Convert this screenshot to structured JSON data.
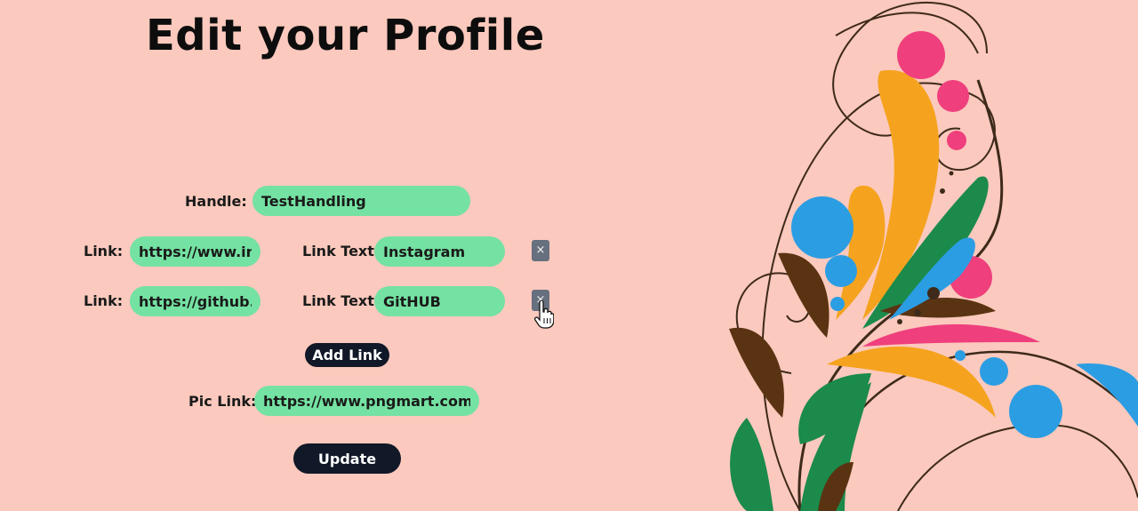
{
  "page": {
    "title": "Edit your Profile"
  },
  "form": {
    "handle_label": "Handle:",
    "handle_value": "TestHandling",
    "links": [
      {
        "link_label": "Link:",
        "link_value": "https://www.instagram.com/",
        "text_label": "Link Text:",
        "text_value": "Instagram",
        "remove_label": "×"
      },
      {
        "link_label": "Link:",
        "link_value": "https://github.com/",
        "text_label": "Link Text:",
        "text_value": "GitHUB",
        "remove_label": "×"
      }
    ],
    "add_link_label": "Add Link",
    "pic_label": "Pic Link:",
    "pic_value": "https://www.pngmart.com/files/",
    "update_label": "Update"
  },
  "colors": {
    "background": "#fbc9bd",
    "field": "#74e2a2",
    "button": "#111827",
    "remove_button": "#66707e"
  },
  "icons": {
    "remove": "close-icon",
    "cursor": "hand-pointer-icon",
    "decoration": "floral-swirl-art"
  }
}
